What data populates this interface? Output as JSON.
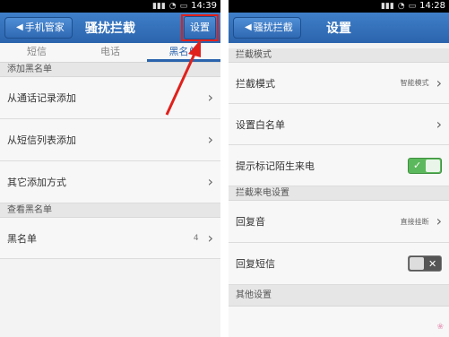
{
  "left": {
    "status": {
      "time": "14:39",
      "signal_icon": "signal-icon",
      "wifi_icon": "wifi-icon",
      "battery_icon": "battery-icon"
    },
    "header": {
      "back_label": "手机管家",
      "title": "骚扰拦截",
      "settings_label": "设置"
    },
    "tabs": [
      {
        "label": "短信"
      },
      {
        "label": "电话"
      },
      {
        "label": "黑名单"
      }
    ],
    "sections": [
      {
        "title": "添加黑名单",
        "items": [
          {
            "label": "从通话记录添加"
          },
          {
            "label": "从短信列表添加"
          },
          {
            "label": "其它添加方式"
          }
        ]
      },
      {
        "title": "查看黑名单",
        "items": [
          {
            "label": "黑名单",
            "count": "4"
          }
        ]
      }
    ]
  },
  "right": {
    "status": {
      "time": "14:28"
    },
    "header": {
      "back_label": "骚扰拦截",
      "title": "设置"
    },
    "sections": [
      {
        "title": "拦截模式",
        "items": [
          {
            "label": "拦截模式",
            "value": "智能模式"
          },
          {
            "label": "设置白名单"
          },
          {
            "label": "提示标记陌生来电",
            "toggle": "on"
          }
        ]
      },
      {
        "title": "拦截来电设置",
        "items": [
          {
            "label": "回复音",
            "value": "直接挂断"
          },
          {
            "label": "回复短信",
            "toggle": "off"
          }
        ]
      },
      {
        "title": "其他设置",
        "items": []
      }
    ]
  },
  "colors": {
    "accent": "#2b64ad",
    "highlight": "#e0201b",
    "toggle_on": "#5cb85c"
  }
}
